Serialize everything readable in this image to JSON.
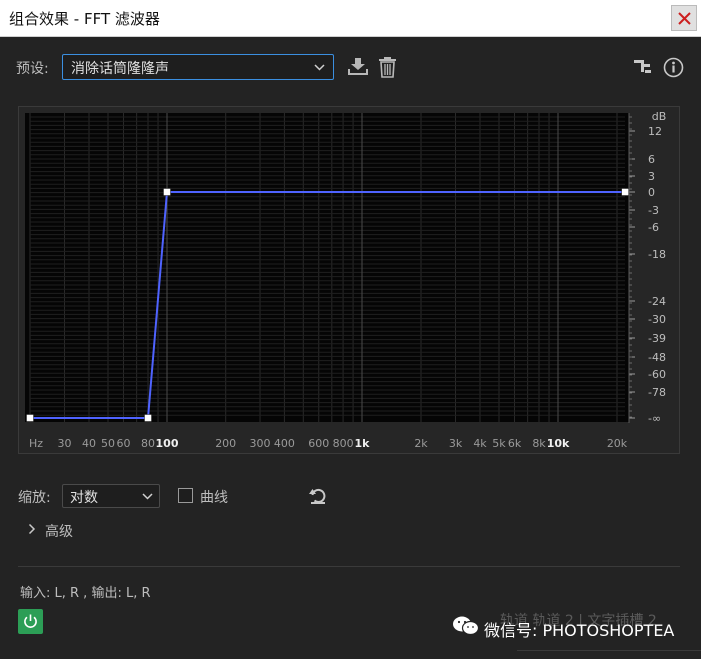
{
  "window": {
    "title": "组合效果 - FFT 滤波器"
  },
  "preset": {
    "label": "预设:",
    "value": "消除话筒隆隆声"
  },
  "icons": {
    "close": "close-icon",
    "save_preset": "download-icon",
    "delete_preset": "trash-icon",
    "routing": "routing-icon",
    "info": "info-icon",
    "reset": "reset-icon",
    "power": "power-icon"
  },
  "chart_data": {
    "type": "line",
    "title": "",
    "xlabel": "Hz",
    "ylabel": "dB",
    "x_scale": "log",
    "xlim": [
      20,
      22000
    ],
    "x_ticks": [
      {
        "label": "Hz",
        "value": 20
      },
      {
        "label": "30",
        "value": 30
      },
      {
        "label": "40",
        "value": 40
      },
      {
        "label": "50",
        "value": 50
      },
      {
        "label": "60",
        "value": 60
      },
      {
        "label": "80",
        "value": 80
      },
      {
        "label": "100",
        "value": 100
      },
      {
        "label": "200",
        "value": 200
      },
      {
        "label": "300",
        "value": 300
      },
      {
        "label": "400",
        "value": 400
      },
      {
        "label": "600",
        "value": 600
      },
      {
        "label": "800",
        "value": 800
      },
      {
        "label": "1k",
        "value": 1000
      },
      {
        "label": "2k",
        "value": 2000
      },
      {
        "label": "3k",
        "value": 3000
      },
      {
        "label": "4k",
        "value": 4000
      },
      {
        "label": "5k",
        "value": 5000
      },
      {
        "label": "6k",
        "value": 6000
      },
      {
        "label": "8k",
        "value": 8000
      },
      {
        "label": "10k",
        "value": 10000
      },
      {
        "label": "20k",
        "value": 20000
      }
    ],
    "y_ticks": [
      {
        "label": "12",
        "value": 12
      },
      {
        "label": "6",
        "value": 6
      },
      {
        "label": "3",
        "value": 3
      },
      {
        "label": "0",
        "value": 0
      },
      {
        "label": "-3",
        "value": -3
      },
      {
        "label": "-6",
        "value": -6
      },
      {
        "label": "-18",
        "value": -18
      },
      {
        "label": "-24",
        "value": -24
      },
      {
        "label": "-30",
        "value": -30
      },
      {
        "label": "-39",
        "value": -39
      },
      {
        "label": "-48",
        "value": -48
      },
      {
        "label": "-60",
        "value": -60
      },
      {
        "label": "-78",
        "value": -78
      },
      {
        "label": "-∞",
        "value": "-inf"
      }
    ],
    "grid": true,
    "series": [
      {
        "points": [
          {
            "x": 20,
            "y": "-inf"
          },
          {
            "x": 80,
            "y": "-inf"
          },
          {
            "x": 100,
            "y": 0
          },
          {
            "x": 22000,
            "y": 0
          }
        ]
      }
    ],
    "colors": {
      "line": "#4f63ff",
      "background": "#050505",
      "grid": "#303030",
      "handle": "#ffffff"
    }
  },
  "scale": {
    "label": "缩放:",
    "value": "对数"
  },
  "curve": {
    "label": "曲线",
    "checked": false
  },
  "advanced": {
    "label": "高级"
  },
  "io": {
    "text": "输入: L, R , 输出: L, R"
  },
  "background_tabs": {
    "text": "轨道 轨道 2   |   文字插槽 2"
  },
  "watermark": {
    "text": "微信号: PHOTOSHOPTEA"
  }
}
